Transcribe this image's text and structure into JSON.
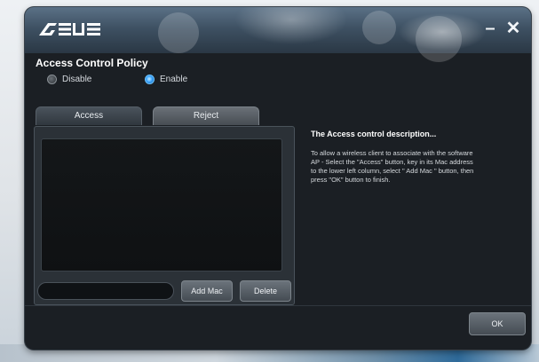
{
  "app": {
    "logo_text": "ASUS"
  },
  "window_controls": {
    "minimize_label": "–",
    "close_label": "✕"
  },
  "policy": {
    "title": "Access Control Policy",
    "options": [
      {
        "label": "Disable",
        "selected": false
      },
      {
        "label": "Enable",
        "selected": true
      }
    ]
  },
  "tabs": [
    {
      "label": "Access",
      "active": false
    },
    {
      "label": "Reject",
      "active": true
    }
  ],
  "mac_list": {
    "items": [],
    "input_value": "",
    "add_label": "Add Mac",
    "delete_label": "Delete"
  },
  "description": {
    "title": "The Access control description...",
    "body": "To allow a wireless client to associate with the software AP - Select the \"Access\" button, key in its Mac address to the lower left column, select \" Add Mac \" button, then press \"OK\" button to finish."
  },
  "footer": {
    "ok_label": "OK"
  },
  "colors": {
    "window_bg": "#1b1f24",
    "accent_radio": "#3ea6ff",
    "title_bar": "#3e5163"
  },
  "icons": {
    "minimize": "minimize-icon",
    "close": "close-icon"
  }
}
